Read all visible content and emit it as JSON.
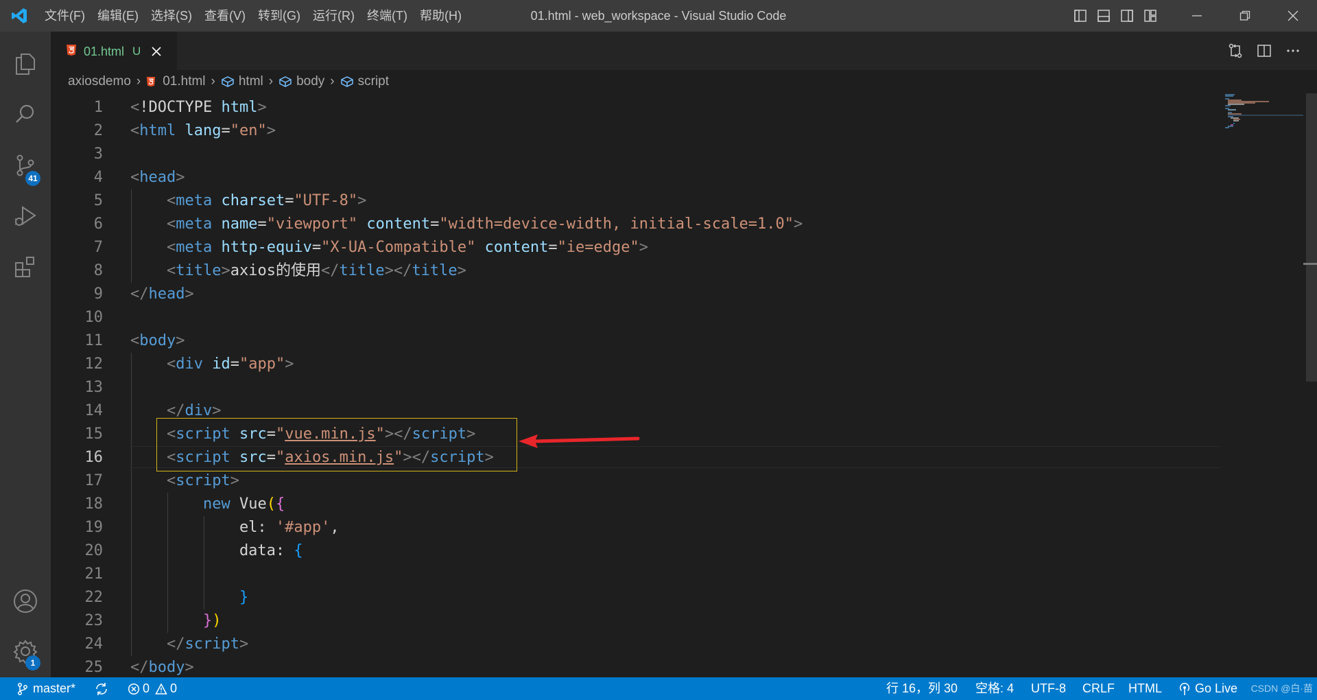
{
  "window": {
    "title": "01.html - web_workspace - Visual Studio Code",
    "menu": [
      "文件(F)",
      "编辑(E)",
      "选择(S)",
      "查看(V)",
      "转到(G)",
      "运行(R)",
      "终端(T)",
      "帮助(H)"
    ]
  },
  "activity_bar": {
    "items": [
      {
        "name": "explorer",
        "icon": "files-icon"
      },
      {
        "name": "search",
        "icon": "search-icon"
      },
      {
        "name": "source-control",
        "icon": "source-control-icon",
        "badge": "41"
      },
      {
        "name": "run-debug",
        "icon": "run-debug-icon"
      },
      {
        "name": "extensions",
        "icon": "extensions-icon"
      }
    ],
    "bottom": [
      {
        "name": "accounts",
        "icon": "account-icon"
      },
      {
        "name": "manage",
        "icon": "gear-icon",
        "badge": "1"
      }
    ]
  },
  "tabs": [
    {
      "label": "01.html",
      "status": "U",
      "active": true,
      "icon": "html5-icon"
    }
  ],
  "breadcrumbs": {
    "folder": "axiosdemo",
    "file": "01.html",
    "symbols": [
      "html",
      "body",
      "script"
    ]
  },
  "editor": {
    "current_line": 16,
    "line_numbers": [
      "1",
      "2",
      "3",
      "4",
      "5",
      "6",
      "7",
      "8",
      "9",
      "10",
      "11",
      "12",
      "13",
      "14",
      "15",
      "16",
      "17",
      "18",
      "19",
      "20",
      "21",
      "22",
      "23",
      "24",
      "25"
    ],
    "lines": [
      {
        "tokens": [
          [
            "br",
            "<"
          ],
          [
            "txt",
            "!DOCTYPE "
          ],
          [
            "attr",
            "html"
          ],
          [
            "br",
            ">"
          ]
        ]
      },
      {
        "tokens": [
          [
            "br",
            "<"
          ],
          [
            "tag",
            "html "
          ],
          [
            "attr",
            "lang"
          ],
          [
            "txt",
            "="
          ],
          [
            "str",
            "\"en\""
          ],
          [
            "br",
            ">"
          ]
        ]
      },
      {
        "tokens": []
      },
      {
        "tokens": [
          [
            "br",
            "<"
          ],
          [
            "tag",
            "head"
          ],
          [
            "br",
            ">"
          ]
        ]
      },
      {
        "tokens": [
          [
            "txt",
            "    "
          ],
          [
            "br",
            "<"
          ],
          [
            "tag",
            "meta "
          ],
          [
            "attr",
            "charset"
          ],
          [
            "txt",
            "="
          ],
          [
            "str",
            "\"UTF-8\""
          ],
          [
            "br",
            ">"
          ]
        ]
      },
      {
        "tokens": [
          [
            "txt",
            "    "
          ],
          [
            "br",
            "<"
          ],
          [
            "tag",
            "meta "
          ],
          [
            "attr",
            "name"
          ],
          [
            "txt",
            "="
          ],
          [
            "str",
            "\"viewport\" "
          ],
          [
            "attr",
            "content"
          ],
          [
            "txt",
            "="
          ],
          [
            "str",
            "\"width=device-width, initial-scale=1.0\""
          ],
          [
            "br",
            ">"
          ]
        ]
      },
      {
        "tokens": [
          [
            "txt",
            "    "
          ],
          [
            "br",
            "<"
          ],
          [
            "tag",
            "meta "
          ],
          [
            "attr",
            "http-equiv"
          ],
          [
            "txt",
            "="
          ],
          [
            "str",
            "\"X-UA-Compatible\" "
          ],
          [
            "attr",
            "content"
          ],
          [
            "txt",
            "="
          ],
          [
            "str",
            "\"ie=edge\""
          ],
          [
            "br",
            ">"
          ]
        ]
      },
      {
        "tokens": [
          [
            "txt",
            "    "
          ],
          [
            "br",
            "<"
          ],
          [
            "tag",
            "title"
          ],
          [
            "br",
            ">"
          ],
          [
            "txt",
            "axios的使用"
          ],
          [
            "br",
            "</"
          ],
          [
            "tag",
            "title"
          ],
          [
            "br",
            "></"
          ],
          [
            "tag",
            "title"
          ],
          [
            "br",
            ">"
          ]
        ]
      },
      {
        "tokens": [
          [
            "br",
            "</"
          ],
          [
            "tag",
            "head"
          ],
          [
            "br",
            ">"
          ]
        ]
      },
      {
        "tokens": []
      },
      {
        "tokens": [
          [
            "br",
            "<"
          ],
          [
            "tag",
            "body"
          ],
          [
            "br",
            ">"
          ]
        ]
      },
      {
        "tokens": [
          [
            "txt",
            "    "
          ],
          [
            "br",
            "<"
          ],
          [
            "tag",
            "div "
          ],
          [
            "attr",
            "id"
          ],
          [
            "txt",
            "="
          ],
          [
            "str",
            "\"app\""
          ],
          [
            "br",
            ">"
          ]
        ]
      },
      {
        "tokens": []
      },
      {
        "tokens": [
          [
            "txt",
            "    "
          ],
          [
            "br",
            "</"
          ],
          [
            "tag",
            "div"
          ],
          [
            "br",
            ">"
          ]
        ]
      },
      {
        "tokens": [
          [
            "txt",
            "    "
          ],
          [
            "br",
            "<"
          ],
          [
            "tag",
            "script "
          ],
          [
            "attr",
            "src"
          ],
          [
            "txt",
            "="
          ],
          [
            "str",
            "\""
          ],
          [
            "strul",
            "vue.min.js"
          ],
          [
            "str",
            "\""
          ],
          [
            "br",
            "></"
          ],
          [
            "tag",
            "script"
          ],
          [
            "br",
            ">"
          ]
        ]
      },
      {
        "tokens": [
          [
            "txt",
            "    "
          ],
          [
            "br",
            "<"
          ],
          [
            "tag",
            "script "
          ],
          [
            "attr",
            "src"
          ],
          [
            "txt",
            "="
          ],
          [
            "str",
            "\""
          ],
          [
            "strul",
            "axios.min.js"
          ],
          [
            "str",
            "\""
          ],
          [
            "br",
            "></"
          ],
          [
            "tag",
            "script"
          ],
          [
            "br",
            ">"
          ]
        ]
      },
      {
        "tokens": [
          [
            "txt",
            "    "
          ],
          [
            "br",
            "<"
          ],
          [
            "tag",
            "script"
          ],
          [
            "br",
            ">"
          ]
        ]
      },
      {
        "tokens": [
          [
            "txt",
            "        "
          ],
          [
            "kw",
            "new "
          ],
          [
            "txt",
            "Vue"
          ],
          [
            "b1",
            "("
          ],
          [
            "b2",
            "{"
          ]
        ]
      },
      {
        "tokens": [
          [
            "txt",
            "            el: "
          ],
          [
            "str",
            "'#app'"
          ],
          [
            "txt",
            ","
          ]
        ]
      },
      {
        "tokens": [
          [
            "txt",
            "            data: "
          ],
          [
            "b3",
            "{"
          ]
        ]
      },
      {
        "tokens": []
      },
      {
        "tokens": [
          [
            "txt",
            "            "
          ],
          [
            "b3",
            "}"
          ]
        ]
      },
      {
        "tokens": [
          [
            "txt",
            "        "
          ],
          [
            "b2",
            "}"
          ],
          [
            "b1",
            ")"
          ]
        ]
      },
      {
        "tokens": [
          [
            "txt",
            "    "
          ],
          [
            "br",
            "</"
          ],
          [
            "tag",
            "script"
          ],
          [
            "br",
            ">"
          ]
        ]
      },
      {
        "tokens": [
          [
            "br",
            "</"
          ],
          [
            "tag",
            "body"
          ],
          [
            "br",
            ">"
          ]
        ]
      }
    ]
  },
  "annotation": {
    "color": "#e8262b",
    "box_color": "#d4b416"
  },
  "statusbar": {
    "branch": "master*",
    "errors": "0",
    "warnings": "0",
    "position": "行 16，列 30",
    "indent": "空格: 4",
    "encoding": "UTF-8",
    "eol": "CRLF",
    "language": "HTML",
    "go_live": "Go Live",
    "watermark": "CSDN @白·苗"
  },
  "colors": {
    "accent": "#007acc",
    "tag": "#569cd6",
    "attr": "#9cdcfe",
    "string": "#ce9178",
    "modified": "#73c991"
  }
}
